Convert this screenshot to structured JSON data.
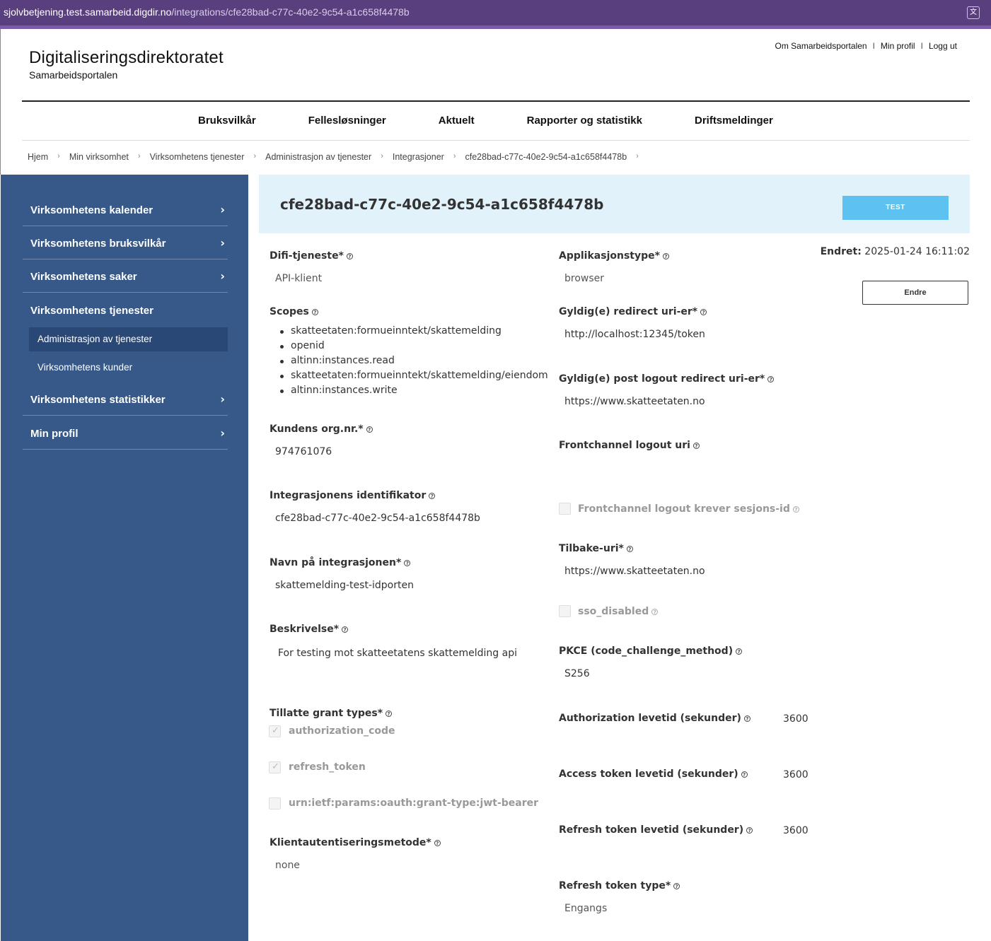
{
  "browser": {
    "url_host": "sjolvbetjening.test.samarbeid.digdir.no",
    "url_path": "/integrations/cfe28bad-c77c-40e2-9c54-a1c658f4478b"
  },
  "header": {
    "org_name": "Digitaliseringsdirektoratet",
    "portal_name": "Samarbeidsportalen",
    "top_links": [
      "Om Samarbeidsportalen",
      "Min profil",
      "Logg ut"
    ],
    "nav": [
      "Bruksvilkår",
      "Fellesløsninger",
      "Aktuelt",
      "Rapporter og statistikk",
      "Driftsmeldinger"
    ]
  },
  "breadcrumb": [
    "Hjem",
    "Min virksomhet",
    "Virksomhetens tjenester",
    "Administrasjon av tjenester",
    "Integrasjoner",
    "cfe28bad-c77c-40e2-9c54-a1c658f4478b"
  ],
  "sidebar": {
    "items": [
      {
        "label": "Virksomhetens kalender"
      },
      {
        "label": "Virksomhetens bruksvilkår"
      },
      {
        "label": "Virksomhetens saker"
      },
      {
        "label": "Virksomhetens tjenester"
      },
      {
        "label": "Virksomhetens statistikker"
      },
      {
        "label": "Min profil"
      }
    ],
    "subitems": [
      {
        "label": "Administrasjon av tjenester"
      },
      {
        "label": "Virksomhetens kunder"
      }
    ]
  },
  "page": {
    "title": "cfe28bad-c77c-40e2-9c54-a1c658f4478b",
    "env_badge": "TEST",
    "changed_label": "Endret:",
    "changed_value": "2025-01-24 16:11:02",
    "edit_button": "Endre"
  },
  "left": {
    "difi_label": "Difi-tjeneste*",
    "difi_value": "API-klient",
    "scopes_label": "Scopes",
    "scopes": [
      "skatteetaten:formueinntekt/skattemelding",
      "openid",
      "altinn:instances.read",
      "skatteetaten:formueinntekt/skattemelding/eiendom",
      "altinn:instances.write"
    ],
    "org_label": "Kundens org.nr.*",
    "org_value": "974761076",
    "ident_label": "Integrasjonens identifikator",
    "ident_value": "cfe28bad-c77c-40e2-9c54-a1c658f4478b",
    "name_label": "Navn på integrasjonen*",
    "name_value": "skattemelding-test-idporten",
    "desc_label": "Beskrivelse*",
    "desc_value": "For testing mot skatteetatens skattemelding api",
    "grant_label": "Tillatte grant types*",
    "grants": [
      "authorization_code",
      "refresh_token",
      "urn:ietf:params:oauth:grant-type:jwt-bearer"
    ],
    "auth_label": "Klientautentiseringsmetode*",
    "auth_value": "none"
  },
  "right": {
    "apptype_label": "Applikasjonstype*",
    "apptype_value": "browser",
    "redirect_label": "Gyldig(e) redirect uri-er*",
    "redirect_value": "http://localhost:12345/token",
    "postlogout_label": "Gyldig(e) post logout redirect uri-er*",
    "postlogout_value": "https://www.skatteetaten.no",
    "frontchannel_label": "Frontchannel logout uri",
    "frontchannel_sid_label": "Frontchannel logout krever sesjons-id",
    "back_label": "Tilbake-uri*",
    "back_value": "https://www.skatteetaten.no",
    "sso_label": "sso_disabled",
    "pkce_label": "PKCE (code_challenge_method)",
    "pkce_value": "S256",
    "authlife_label": "Authorization levetid (sekunder)",
    "authlife_value": "3600",
    "accesslife_label": "Access token levetid (sekunder)",
    "accesslife_value": "3600",
    "refreshlife_label": "Refresh token levetid (sekunder)",
    "refreshlife_value": "3600",
    "refreshtype_label": "Refresh token type*",
    "refreshtype_value": "Engangs"
  },
  "colors": {
    "sidebar_bg": "#365989",
    "title_band": "#e2f2fb",
    "test_badge": "#5ec2f0",
    "browser_bar": "#5a3f7e"
  }
}
